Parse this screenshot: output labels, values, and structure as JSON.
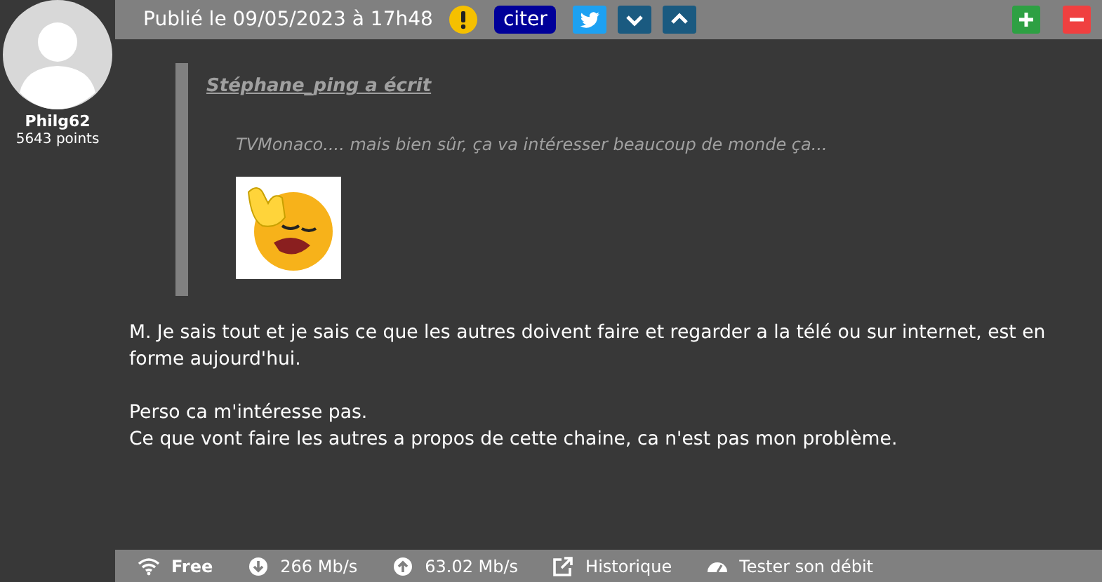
{
  "author": {
    "name": "Philg62",
    "points": "5643 points"
  },
  "header": {
    "published": "Publié le 09/05/2023 à 17h48",
    "quote_button": "citer"
  },
  "quote": {
    "author_line": "Stéphane_ping a écrit",
    "text": "TVMonaco.... mais bien sûr, ça va intéresser beaucoup de monde ça..."
  },
  "body": [
    [
      "M. Je sais tout et je sais ce que les autres doivent faire et regarder a la télé ou sur internet, est en forme aujourd'hui."
    ],
    [
      "Perso ca m'intéresse pas.",
      "Ce que vont faire les autres a propos de cette chaine, ca n'est pas mon problème."
    ]
  ],
  "status_bar": [
    {
      "kind": "wifi",
      "label": "Free"
    },
    {
      "kind": "download",
      "label": "266 Mb/s"
    },
    {
      "kind": "upload",
      "label": "63.02 Mb/s"
    },
    {
      "kind": "history",
      "label": "Historique"
    },
    {
      "kind": "speed",
      "label": "Tester son débit"
    }
  ]
}
